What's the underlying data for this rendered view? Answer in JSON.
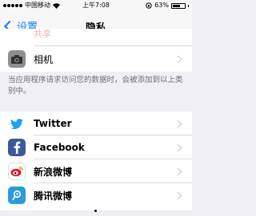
{
  "status": {
    "carrier": "中国移动",
    "time": "上午7:08",
    "battery_percent": "63%",
    "battery_level": 0.63
  },
  "nav": {
    "back_label": "设置",
    "title": "隐私"
  },
  "top_group": {
    "clipped_label": "共享",
    "camera_label": "相机"
  },
  "explanation": "当应用程序请求访问您的数据时，会被添加到以上类别中。",
  "social_group": [
    {
      "label": "Twitter",
      "icon": "twitter-icon",
      "color": "#1da1f2"
    },
    {
      "label": "Facebook",
      "icon": "facebook-icon",
      "color": "#3b5998"
    },
    {
      "label": "新浪微博",
      "icon": "sina-weibo-icon",
      "color": "#e6162d"
    },
    {
      "label": "腾讯微博",
      "icon": "tencent-weibo-icon",
      "color": "#2b9cd8"
    }
  ]
}
